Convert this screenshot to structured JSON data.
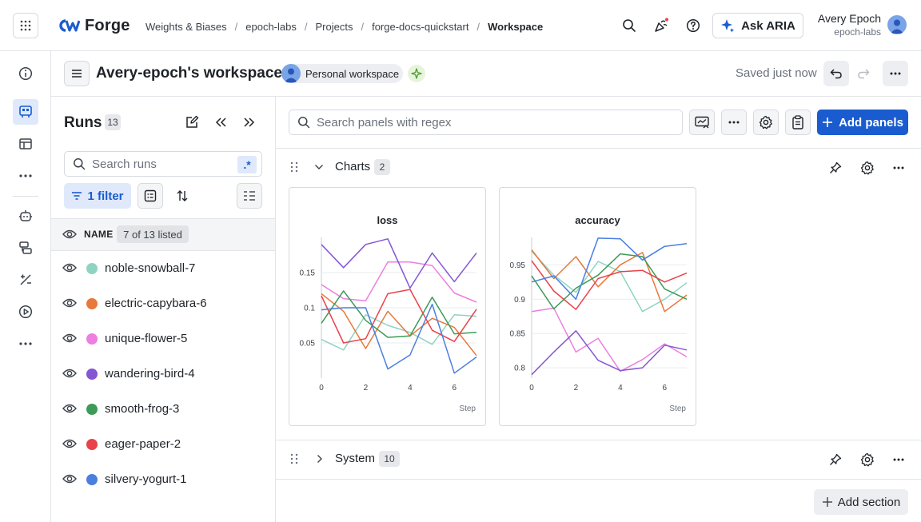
{
  "brand": {
    "name": "Forge"
  },
  "breadcrumbs": [
    {
      "label": "Weights & Biases"
    },
    {
      "label": "epoch-labs"
    },
    {
      "label": "Projects"
    },
    {
      "label": "forge-docs-quickstart"
    },
    {
      "label": "Workspace"
    }
  ],
  "topbar": {
    "aria_label": "Ask ARIA"
  },
  "user": {
    "name": "Avery Epoch",
    "org": "epoch-labs"
  },
  "workspace": {
    "title": "Avery-epoch's workspace",
    "badge": "Personal workspace",
    "saved_status": "Saved just now"
  },
  "runs": {
    "title": "Runs",
    "count": "13",
    "search_placeholder": "Search runs",
    "regex_label": ".*",
    "filter_label": "1 filter",
    "column_name": "NAME",
    "listed_label": "7 of 13 listed",
    "items": [
      {
        "name": "noble-snowball-7",
        "color": "#8fd4c1"
      },
      {
        "name": "electric-capybara-6",
        "color": "#e8783c"
      },
      {
        "name": "unique-flower-5",
        "color": "#ec7fe0"
      },
      {
        "name": "wandering-bird-4",
        "color": "#8456d4"
      },
      {
        "name": "smooth-frog-3",
        "color": "#3d9a57"
      },
      {
        "name": "eager-paper-2",
        "color": "#e8424a"
      },
      {
        "name": "silvery-yogurt-1",
        "color": "#4a7fe0"
      }
    ]
  },
  "main": {
    "search_placeholder": "Search panels with regex",
    "add_panels_label": "Add panels",
    "add_section_label": "Add section",
    "sections": [
      {
        "title": "Charts",
        "count": "2",
        "expanded": true
      },
      {
        "title": "System",
        "count": "10",
        "expanded": false
      }
    ]
  },
  "chart_data": [
    {
      "type": "line",
      "title": "loss",
      "xlabel": "Step",
      "ylabel": "",
      "xlim": [
        0,
        7
      ],
      "ylim": [
        0.0,
        0.2
      ],
      "xticks": [
        0,
        2,
        4,
        6
      ],
      "yticks": [
        0.05,
        0.1,
        0.15
      ],
      "x": [
        0,
        1,
        2,
        3,
        4,
        5,
        6,
        7
      ],
      "series": [
        {
          "color": "#8fd4c1",
          "values": [
            0.055,
            0.04,
            0.09,
            0.075,
            0.065,
            0.048,
            0.09,
            0.088
          ]
        },
        {
          "color": "#e8783c",
          "values": [
            0.12,
            0.095,
            0.042,
            0.095,
            0.06,
            0.085,
            0.072,
            0.032
          ]
        },
        {
          "color": "#ec7fe0",
          "values": [
            0.133,
            0.113,
            0.11,
            0.165,
            0.165,
            0.16,
            0.121,
            0.108
          ]
        },
        {
          "color": "#8456d4",
          "values": [
            0.19,
            0.157,
            0.19,
            0.198,
            0.128,
            0.178,
            0.137,
            0.178
          ]
        },
        {
          "color": "#3d9a57",
          "values": [
            0.078,
            0.124,
            0.082,
            0.058,
            0.06,
            0.115,
            0.063,
            0.065
          ]
        },
        {
          "color": "#e8424a",
          "values": [
            0.117,
            0.05,
            0.056,
            0.12,
            0.126,
            0.068,
            0.052,
            0.098
          ]
        },
        {
          "color": "#4a7fe0",
          "values": [
            0.097,
            0.1,
            0.1,
            0.013,
            0.033,
            0.105,
            0.007,
            0.03
          ]
        }
      ]
    },
    {
      "type": "line",
      "title": "accuracy",
      "xlabel": "Step",
      "ylabel": "",
      "xlim": [
        0,
        7
      ],
      "ylim": [
        0.785,
        0.99
      ],
      "xticks": [
        0,
        2,
        4,
        6
      ],
      "yticks": [
        0.8,
        0.85,
        0.9,
        0.95
      ],
      "x": [
        0,
        1,
        2,
        3,
        4,
        5,
        6,
        7
      ],
      "series": [
        {
          "color": "#8fd4c1",
          "values": [
            0.97,
            0.935,
            0.91,
            0.955,
            0.94,
            0.882,
            0.9,
            0.924
          ]
        },
        {
          "color": "#e8783c",
          "values": [
            0.972,
            0.93,
            0.962,
            0.918,
            0.95,
            0.968,
            0.882,
            0.906
          ]
        },
        {
          "color": "#ec7fe0",
          "values": [
            0.882,
            0.887,
            0.823,
            0.843,
            0.795,
            0.812,
            0.835,
            0.816
          ]
        },
        {
          "color": "#8456d4",
          "values": [
            0.79,
            0.823,
            0.854,
            0.811,
            0.796,
            0.8,
            0.833,
            0.826
          ]
        },
        {
          "color": "#3d9a57",
          "values": [
            0.934,
            0.886,
            0.916,
            0.935,
            0.966,
            0.962,
            0.915,
            0.9
          ]
        },
        {
          "color": "#e8424a",
          "values": [
            0.956,
            0.912,
            0.885,
            0.93,
            0.94,
            0.942,
            0.925,
            0.938
          ]
        },
        {
          "color": "#4a7fe0",
          "values": [
            0.925,
            0.934,
            0.9,
            0.989,
            0.988,
            0.957,
            0.977,
            0.981
          ]
        }
      ]
    }
  ]
}
